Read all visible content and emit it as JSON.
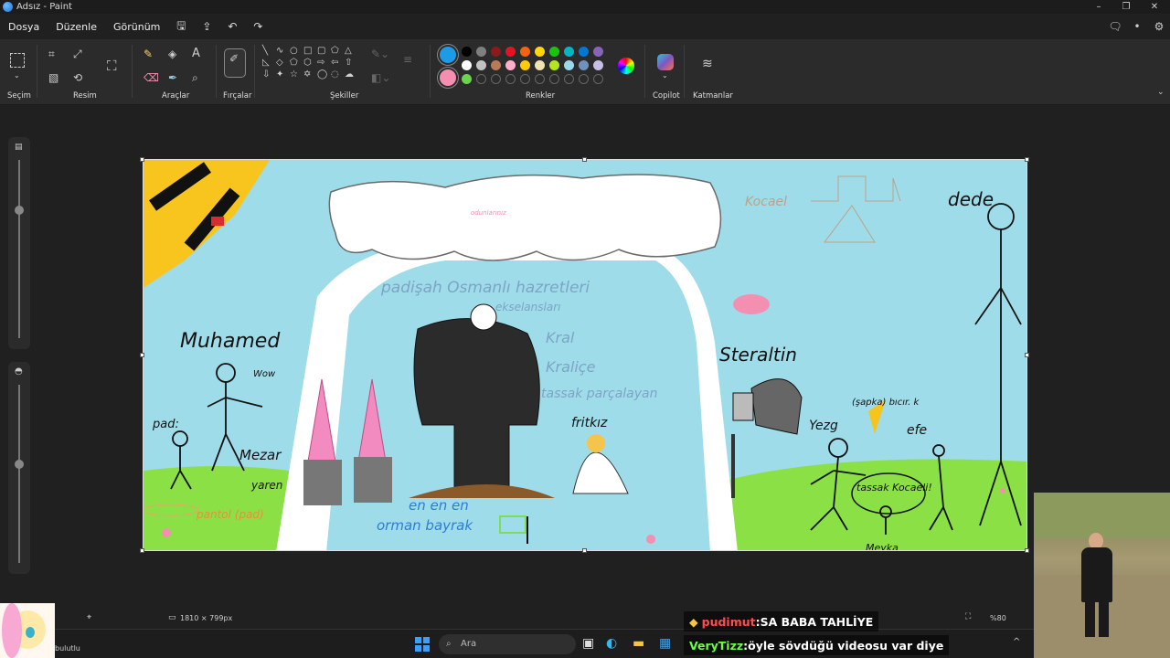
{
  "window": {
    "title": "Adsız - Paint"
  },
  "menu": {
    "file": "Dosya",
    "edit": "Düzenle",
    "view": "Görünüm"
  },
  "ribbon": {
    "selection_label": "Seçim",
    "image_label": "Resim",
    "tools_label": "Araçlar",
    "brushes_label": "Fırçalar",
    "shapes_label": "Şekiller",
    "colors_label": "Renkler",
    "copilot_label": "Copilot",
    "layers_label": "Katmanlar",
    "text_tool_glyph": "A",
    "primary_color": "#1e9be6",
    "secondary_color": "#f48fb1",
    "swatch_colors": [
      "#000000",
      "#7f7f7f",
      "#8b1a1a",
      "#e81123",
      "#f7630c",
      "#ffd800",
      "#16c60c",
      "#00b7c3",
      "#0078d4",
      "#8764b8",
      "#ffffff",
      "#c3c3c3",
      "#b97a57",
      "#ffaec9",
      "#ffc90e",
      "#efe4b0",
      "#b5e61d",
      "#99d9ea",
      "#7092be",
      "#c8bfe7",
      "#6cd34f",
      "#2b2b2b",
      "#2b2b2b",
      "#2b2b2b",
      "#2b2b2b",
      "#2b2b2b",
      "#2b2b2b",
      "#2b2b2b",
      "#2b2b2b",
      "#2b2b2b"
    ]
  },
  "canvas_text": {
    "mehmet": "Muhamed",
    "padisah": "padişah Osmanlı hazretleri",
    "ekselans": "ekselansları",
    "kral": "Kral",
    "kralice": "Kraliçe",
    "tassak": "tassak parçalayan",
    "fritkiz": "fritkız",
    "steraltin": "Steraltin",
    "kocaeli_top": "Kocael",
    "dede": "dede",
    "mezar": "Mezar",
    "yaren": "yaren",
    "pad": "pad:",
    "pantol": "pantol (pad)",
    "enenen": "en en en",
    "orman": "orman bayrak",
    "yezg": "Yezg",
    "efe": "efe",
    "sapka": "(şapka) bıcır. k",
    "tassak_kocaeli": "tassak Kocaeli!",
    "meyka": "Meyka",
    "wow": "Wow",
    "cloud_small": "odunlarınız"
  },
  "status": {
    "canvas_size": "1810 × 799px",
    "zoom": "%80",
    "weather": "bulutlu"
  },
  "taskbar": {
    "search_placeholder": "Ara"
  },
  "chat": [
    {
      "user": "pudimut",
      "message": "SA BABA TAHLİYE",
      "user_color": "#ff4d4d"
    },
    {
      "user": "VeryTizz",
      "message": "öyle sövdüğü videosu var diye",
      "user_color": "#6cff3c"
    }
  ]
}
